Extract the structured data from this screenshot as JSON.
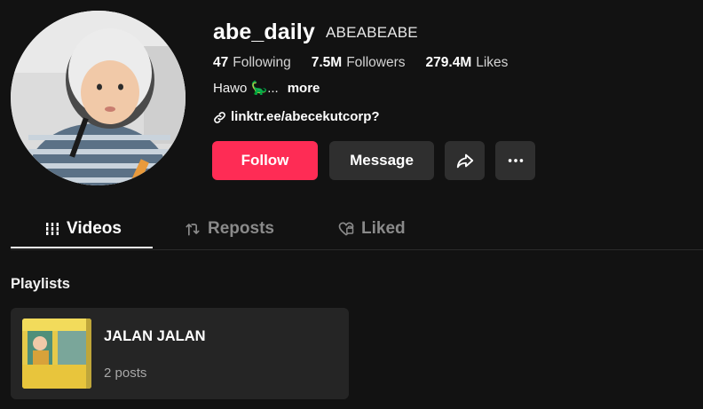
{
  "profile": {
    "username": "abe_daily",
    "nickname": "ABEABEABE",
    "bio": "Hawo 🦕...",
    "bio_more": "more",
    "link": "linktr.ee/abecekutcorp?"
  },
  "stats": [
    {
      "value": "47",
      "label": "Following"
    },
    {
      "value": "7.5M",
      "label": "Followers"
    },
    {
      "value": "279.4M",
      "label": "Likes"
    }
  ],
  "actions": {
    "follow_label": "Follow",
    "message_label": "Message",
    "share_icon": "share-icon",
    "more_icon": "more-icon"
  },
  "tabs": [
    {
      "label": "Videos",
      "icon": "grid-icon",
      "active": true
    },
    {
      "label": "Reposts",
      "icon": "repost-icon",
      "active": false
    },
    {
      "label": "Liked",
      "icon": "heart-icon",
      "active": false
    }
  ],
  "playlists": {
    "title": "Playlists",
    "items": [
      {
        "name": "JALAN JALAN",
        "count": "2 posts"
      }
    ]
  },
  "colors": {
    "background": "#121212",
    "follow_button": "#fe2c55",
    "secondary_button": "#2f2f2f",
    "card": "#252525",
    "inactive_tab": "#8a8a8a"
  }
}
